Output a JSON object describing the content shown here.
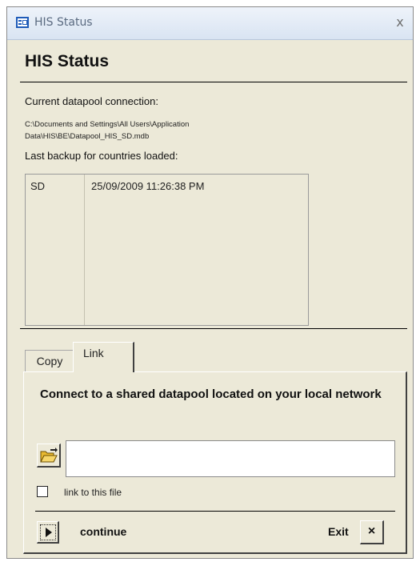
{
  "window": {
    "title": "HIS Status",
    "close_glyph": "x"
  },
  "form": {
    "heading": "HIS Status",
    "connection_label": "Current datapool connection:",
    "connection_path": "C:\\Documents and Settings\\All Users\\Application Data\\HIS\\BE\\Datapool_HIS_SD.mdb",
    "backup_label": "Last backup for countries loaded:",
    "backups": [
      {
        "country": "SD",
        "timestamp": "25/09/2009 11:26:38 PM"
      }
    ]
  },
  "tabs": [
    {
      "label": "Copy",
      "active": false
    },
    {
      "label": "Link",
      "active": true
    }
  ],
  "link_panel": {
    "heading": "Connect to a shared datapool located on your local network",
    "file_value": "",
    "checkbox_label": "link to this file",
    "checkbox_checked": false,
    "continue_label": "continue",
    "exit_label": "Exit",
    "exit_glyph": "×"
  },
  "icons": {
    "app": "form-window-icon",
    "folder": "open-folder-icon",
    "play": "play-arrow-icon",
    "close": "close-icon"
  },
  "colors": {
    "window_bg": "#ece9d8",
    "titlebar": "#dfe8f4",
    "accent": "#1e5bb8",
    "folder": "#e8b931"
  }
}
